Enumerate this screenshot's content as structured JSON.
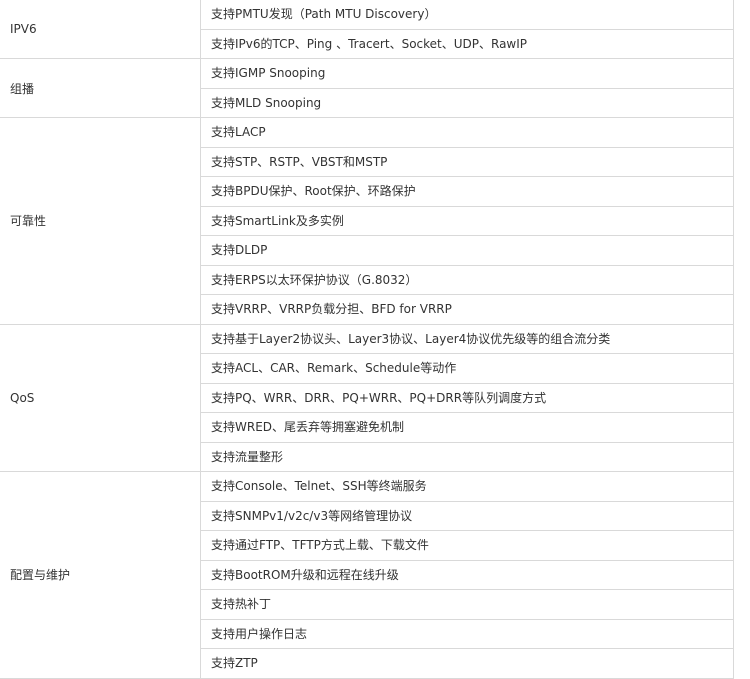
{
  "sections": [
    {
      "name": "IPV6",
      "rows": [
        "支持PMTU发现（Path MTU Discovery）",
        "支持IPv6的TCP、Ping 、Tracert、Socket、UDP、RawIP"
      ]
    },
    {
      "name": "组播",
      "rows": [
        "支持IGMP Snooping",
        "支持MLD Snooping"
      ]
    },
    {
      "name": "可靠性",
      "rows": [
        "支持LACP",
        "支持STP、RSTP、VBST和MSTP",
        "支持BPDU保护、Root保护、环路保护",
        "支持SmartLink及多实例",
        "支持DLDP",
        "支持ERPS以太环保护协议（G.8032）",
        "支持VRRP、VRRP负载分担、BFD for VRRP"
      ]
    },
    {
      "name": "QoS",
      "rows": [
        "支持基于Layer2协议头、Layer3协议、Layer4协议优先级等的组合流分类",
        "支持ACL、CAR、Remark、Schedule等动作",
        "支持PQ、WRR、DRR、PQ+WRR、PQ+DRR等队列调度方式",
        "支持WRED、尾丢弃等拥塞避免机制",
        "支持流量整形"
      ]
    },
    {
      "name": "配置与维护",
      "rows": [
        "支持Console、Telnet、SSH等终端服务",
        "支持SNMPv1/v2c/v3等网络管理协议",
        "支持通过FTP、TFTP方式上载、下载文件",
        "支持BootROM升级和远程在线升级",
        "支持热补丁",
        "支持用户操作日志",
        "支持ZTP"
      ]
    }
  ]
}
